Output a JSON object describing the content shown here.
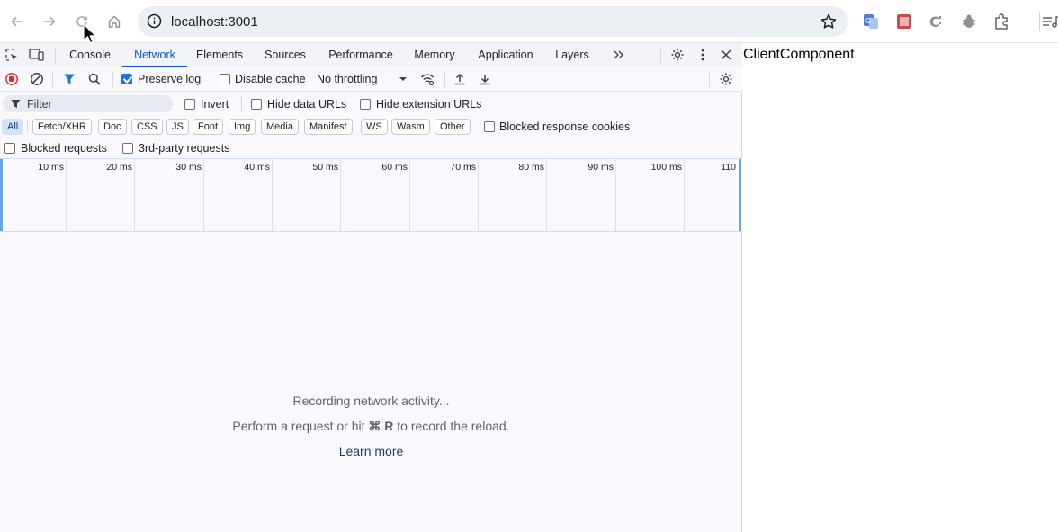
{
  "browser": {
    "url": "localhost:3001",
    "colors": {
      "omnibox_bg": "#eceff4",
      "accent": "#0b57d0"
    }
  },
  "devtools": {
    "tabs": [
      "Console",
      "Network",
      "Elements",
      "Sources",
      "Performance",
      "Memory",
      "Application",
      "Layers"
    ],
    "active_tab": "Network",
    "toolbar": {
      "preserve_log": {
        "label": "Preserve log",
        "checked": true
      },
      "disable_cache": {
        "label": "Disable cache",
        "checked": false
      },
      "throttling": "No throttling"
    },
    "filter": {
      "placeholder": "Filter",
      "invert": "Invert",
      "hide_data_urls": "Hide data URLs",
      "hide_extension_urls": "Hide extension URLs"
    },
    "types": [
      "All",
      "Fetch/XHR",
      "Doc",
      "CSS",
      "JS",
      "Font",
      "Img",
      "Media",
      "Manifest",
      "WS",
      "Wasm",
      "Other"
    ],
    "active_type": "All",
    "blocked_response_cookies": "Blocked response cookies",
    "blocked_requests": "Blocked requests",
    "third_party_requests": "3rd-party requests",
    "timeline_labels": [
      "10 ms",
      "20 ms",
      "30 ms",
      "40 ms",
      "50 ms",
      "60 ms",
      "70 ms",
      "80 ms",
      "90 ms",
      "100 ms",
      "110"
    ],
    "empty_state": {
      "line1": "Recording network activity...",
      "line2_prefix": "Perform a request or hit ",
      "line2_shortcut": "⌘ R",
      "line2_suffix": " to record the reload.",
      "link": "Learn more"
    }
  },
  "page": {
    "text": "ClientComponent"
  }
}
